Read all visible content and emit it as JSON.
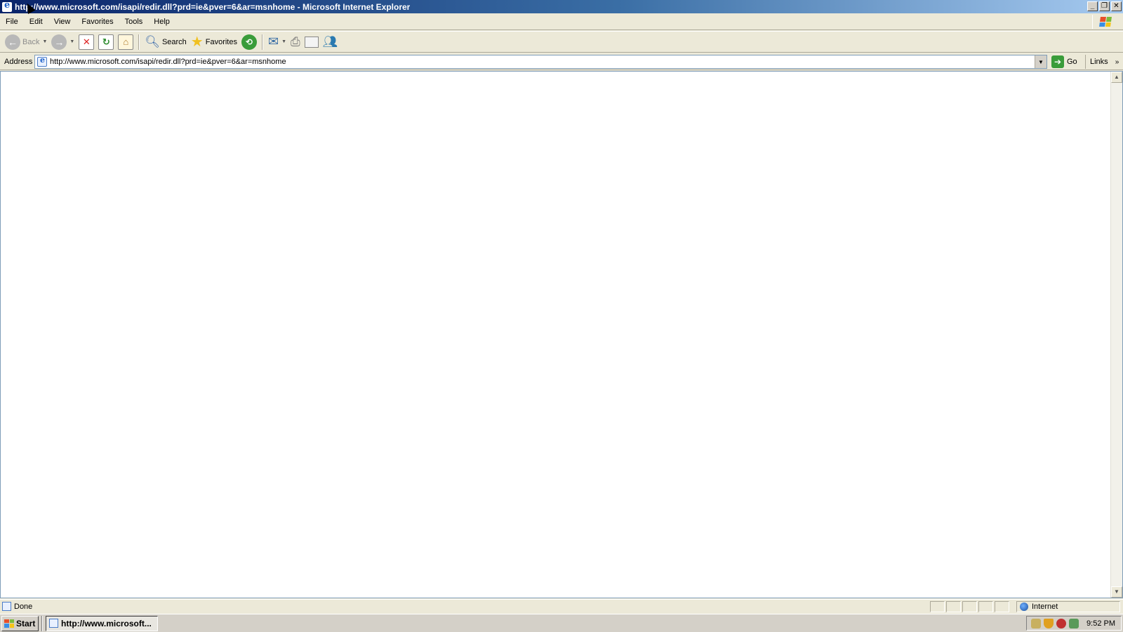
{
  "window": {
    "title": "http://www.microsoft.com/isapi/redir.dll?prd=ie&pver=6&ar=msnhome - Microsoft Internet Explorer",
    "buttons": [
      "minimize",
      "restore",
      "close"
    ]
  },
  "menu": {
    "items": [
      "File",
      "Edit",
      "View",
      "Favorites",
      "Tools",
      "Help"
    ]
  },
  "toolbar": {
    "back_label": "Back",
    "search_label": "Search",
    "favorites_label": "Favorites"
  },
  "address": {
    "label": "Address",
    "url": "http://www.microsoft.com/isapi/redir.dll?prd=ie&pver=6&ar=msnhome",
    "go_label": "Go",
    "links_label": "Links"
  },
  "status": {
    "text": "Done",
    "zone": "Internet"
  },
  "taskbar": {
    "start_label": "Start",
    "task_label": "http://www.microsoft...",
    "clock": "9:52 PM"
  },
  "colors": {
    "titlebar_start": "#0a246a",
    "titlebar_end": "#a6caf0",
    "chrome": "#ece9d8",
    "content_bg": "#ffffff"
  }
}
